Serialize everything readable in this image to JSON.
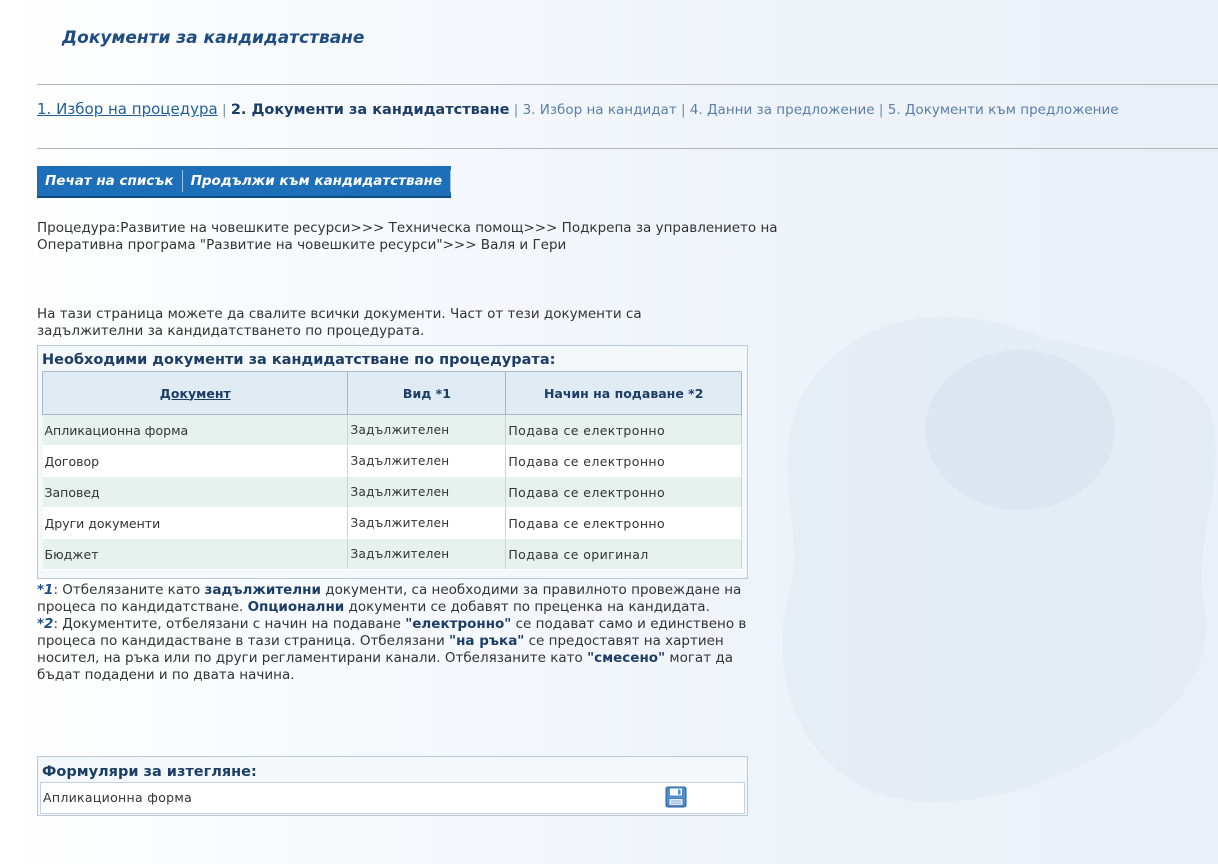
{
  "page": {
    "title": "Документи за кандидатстване"
  },
  "steps": {
    "step1": "1. Избор на процедура",
    "step2": "2. Документи за кандидатстване",
    "step3": "3. Избор на кандидат",
    "step4": "4. Данни за предложение",
    "step5": "5. Документи към предложение"
  },
  "toolbar": {
    "print_label": "Печат на списък",
    "continue_label": "Продължи към кандидатстване"
  },
  "procedure": {
    "text": "Процедура:Развитие на човешките ресурси>>> Техническа помощ>>> Подкрепа за управлението на Оперативна програма \"Развитие на човешките ресурси\">>> Валя и Гери"
  },
  "intro": {
    "text": "На тази страница можете да свалите всички документи. Част от тези документи са задължителни за кандидатстването по процедурата."
  },
  "documents": {
    "title": "Необходими документи за кандидатстване по процедурата:",
    "headers": [
      "Документ",
      "Вид *1",
      "Начин на подаване *2"
    ],
    "rows": [
      [
        "Апликационна форма",
        "Задължителен",
        "Подава се електронно"
      ],
      [
        "Договор",
        "Задължителен",
        "Подава се електронно"
      ],
      [
        "Заповед",
        "Задължителен",
        "Подава се електронно"
      ],
      [
        "Други документи",
        "Задължителен",
        "Подава се електронно"
      ],
      [
        "Бюджет",
        "Задължителен",
        "Подава се оригинал"
      ]
    ]
  },
  "notes": {
    "n1_mark": "*1",
    "n1_a": ": Отбелязаните като ",
    "n1_b": "задължителни",
    "n1_c": " документи, са необходими за правилното провеждане на процеса по кандидатстване. ",
    "n1_d": "Опционални",
    "n1_e": " документи се добавят по преценка на кандидата.",
    "n2_mark": "*2",
    "n2_a": ": Документите, отбелязани с начин на подаване ",
    "n2_b": "\"електронно\"",
    "n2_c": " се подават само и единствено в процеса по кандидастване в тази страница. Отбелязани ",
    "n2_d": "\"на ръка\"",
    "n2_e": " се предоставят на хартиен носител, на ръка или по други регламентирани канали. Отбелязаните като ",
    "n2_f": "\"смесено\"",
    "n2_g": " могат да бъдат подадени и по двата начина."
  },
  "forms": {
    "title": "Формуляри за изтегляне:",
    "items": [
      {
        "label": "Апликационна форма",
        "icon": "save-icon"
      }
    ]
  },
  "colors": {
    "accent": "#1c6fb8",
    "title": "#1f4d82",
    "row_alt": "#e7f1ee"
  }
}
